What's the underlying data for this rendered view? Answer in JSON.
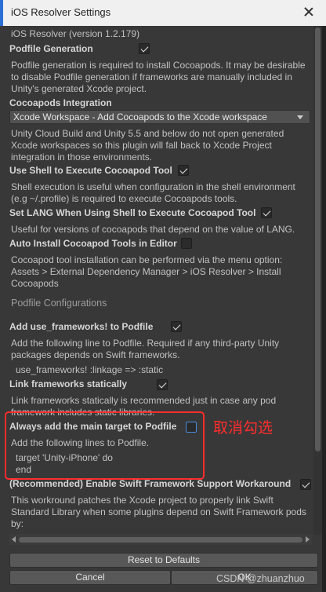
{
  "window": {
    "title": "iOS Resolver Settings"
  },
  "header": {
    "version_text": "iOS Resolver (version 1.2.179)"
  },
  "podfile_generation": {
    "label": "Podfile Generation",
    "checked": true,
    "description": "Podfile generation is required to install Cocoapods.  It may be desirable to disable Podfile generation if frameworks are manually included in Unity's generated Xcode project."
  },
  "cocoapods_integration": {
    "label": "Cocoapods Integration",
    "selected": "Xcode Workspace - Add Cocoapods to the Xcode workspace",
    "description": "Unity Cloud Build and Unity 5.5 and below do not open generated Xcode workspaces so this plugin will fall back to Xcode Project integration in those environments."
  },
  "use_shell": {
    "label": "Use Shell to Execute Cocoapod Tool",
    "checked": true,
    "description": "Shell execution is useful when configuration in the shell environment (e.g ~/.profile) is required to execute Cocoapods tools."
  },
  "set_lang": {
    "label": "Set LANG When Using Shell to Execute Cocoapod Tool",
    "checked": true,
    "description": "Useful for versions of cocoapods that depend on the value of LANG."
  },
  "auto_install": {
    "label": "Auto Install Cocoapod Tools in Editor",
    "checked": false,
    "description": "Cocoapod tool installation can be performed via the menu option: Assets > External Dependency Manager > iOS Resolver > Install Cocoapods"
  },
  "podfile_configurations": {
    "section_title": "Podfile Configurations"
  },
  "use_frameworks": {
    "label": "Add use_frameworks! to Podfile",
    "checked": true,
    "description": "Add the following line to Podfile. Required if any third-party Unity packages depends on Swift frameworks.",
    "code": "use_frameworks! :linkage => :static"
  },
  "link_static": {
    "label": "Link frameworks statically",
    "checked": true,
    "description": "Link frameworks statically is recommended just in case any pod framework includes static libraries."
  },
  "main_target": {
    "label": "Always add the main target to Podfile",
    "checked": false,
    "description": "Add the following lines to Podfile.",
    "code_line1": "target 'Unity-iPhone' do",
    "code_line2": "end"
  },
  "swift_workaround": {
    "label": "(Recommended) Enable Swift Framework Support Workaround",
    "checked": true,
    "description": "This workround patches the Xcode project to properly link Swift Standard Library when some plugins depend on Swift Framework pods by:"
  },
  "buttons": {
    "reset": "Reset to Defaults",
    "cancel": "Cancel",
    "ok": "OK"
  },
  "annotation": {
    "text": "取消勾选",
    "color": "#ff2d2d"
  },
  "watermark": "CSDN @zhuanzhuo"
}
